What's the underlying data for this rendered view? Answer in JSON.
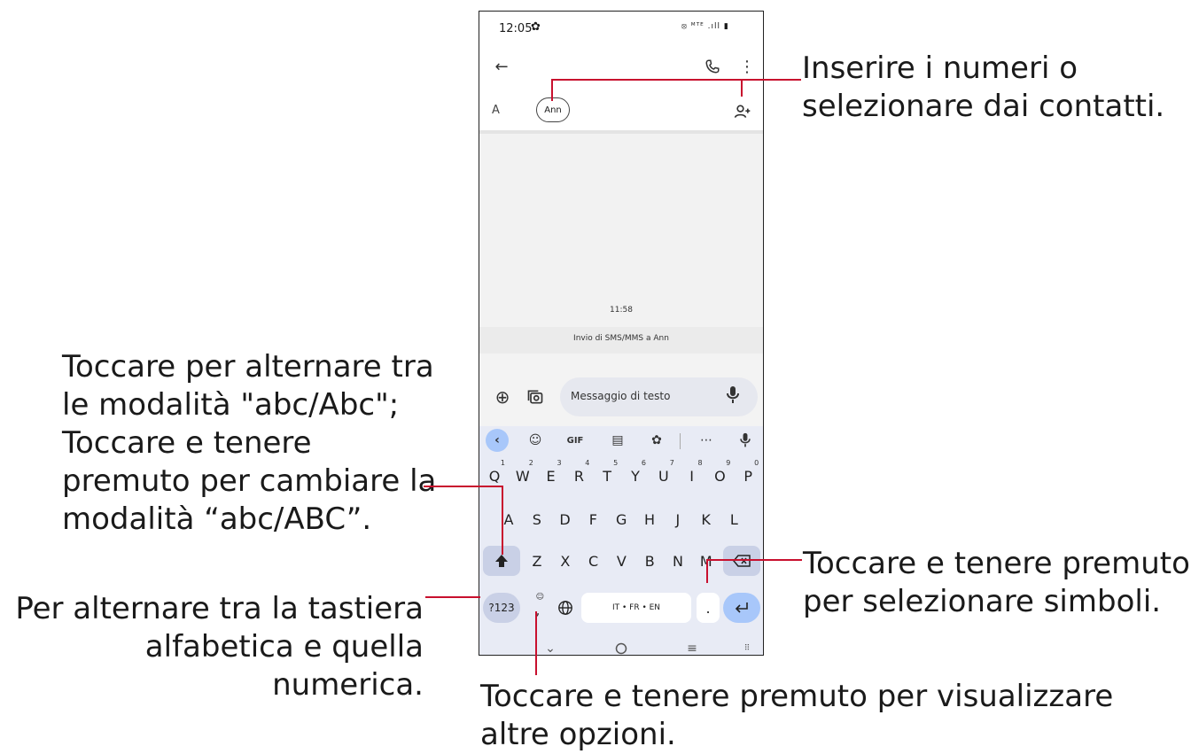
{
  "status_bar": {
    "time": "12:05",
    "icons": "⦻ ᴹᵀᴱ .ıll ▮"
  },
  "recipient": {
    "field_label": "A",
    "chip": "Ann"
  },
  "conversation": {
    "timestamp": "11:58",
    "info": "Invio di SMS/MMS a Ann"
  },
  "compose": {
    "placeholder": "Messaggio di testo"
  },
  "keyboard": {
    "toolbar": {
      "gif": "GIF",
      "more": "⋯"
    },
    "row1": [
      {
        "k": "Q",
        "n": "1"
      },
      {
        "k": "W",
        "n": "2"
      },
      {
        "k": "E",
        "n": "3"
      },
      {
        "k": "R",
        "n": "4"
      },
      {
        "k": "T",
        "n": "5"
      },
      {
        "k": "Y",
        "n": "6"
      },
      {
        "k": "U",
        "n": "7"
      },
      {
        "k": "I",
        "n": "8"
      },
      {
        "k": "O",
        "n": "9"
      },
      {
        "k": "P",
        "n": "0"
      }
    ],
    "row2": [
      "A",
      "S",
      "D",
      "F",
      "G",
      "H",
      "J",
      "K",
      "L"
    ],
    "row3": [
      "Z",
      "X",
      "C",
      "V",
      "B",
      "N",
      "M"
    ],
    "symbols_key": "?123",
    "comma_key": ",",
    "space_key": "IT • FR • EN",
    "period_key": "."
  },
  "annotations": {
    "top_right": [
      "Inserire i numeri o",
      "selezionare dai contatti."
    ],
    "shift": [
      "Toccare per alternare tra",
      "le modalità \"abc/Abc\";",
      "Toccare e tenere",
      "premuto per cambiare la",
      "modalità “abc/ABC”."
    ],
    "numeric": [
      "Per alternare tra la tastiera",
      "alfabetica e quella numerica."
    ],
    "symbols": [
      "Toccare e tenere premuto",
      "per selezionare simboli."
    ],
    "options": [
      "Toccare e tenere premuto per visualizzare",
      "altre opzioni."
    ]
  },
  "colors": {
    "accent_line": "#c8102e",
    "kbd_bg": "#e8ebf5",
    "key_special": "#c9d0e6",
    "enter_key": "#a8c7fa"
  }
}
